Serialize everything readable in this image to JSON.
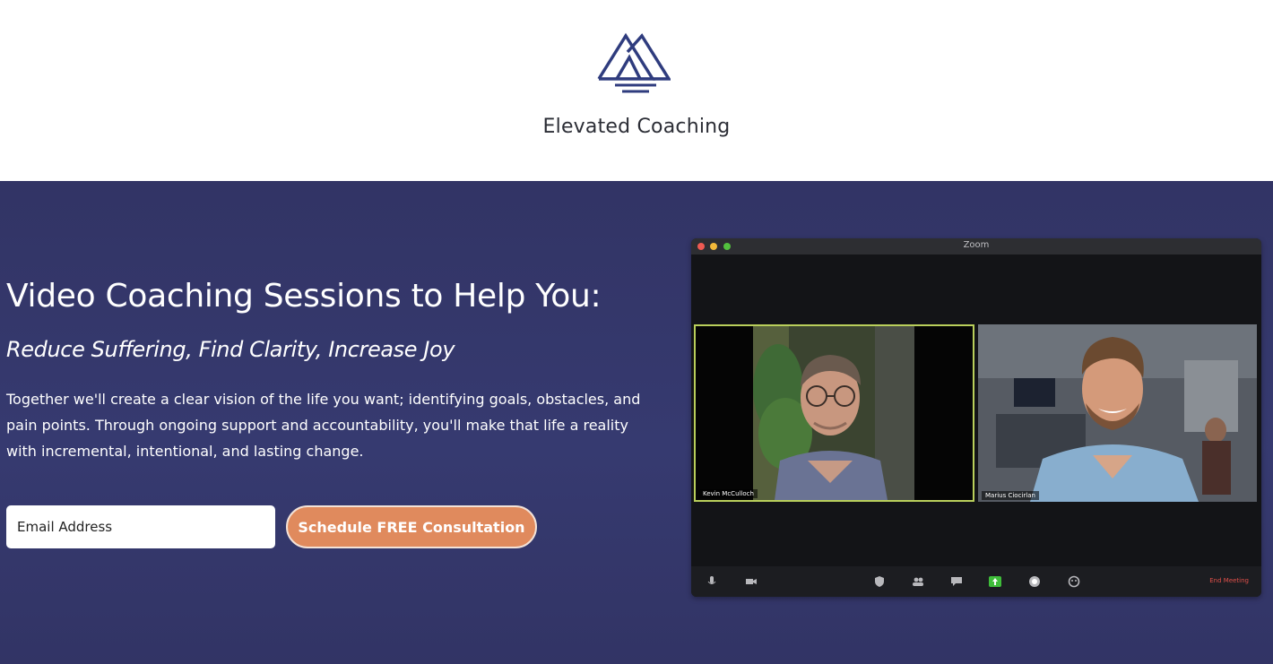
{
  "brand": {
    "name": "Elevated Coaching",
    "logo_icon": "mountain-logo-icon",
    "logo_color": "#2f3c7e"
  },
  "hero": {
    "headline": "Video Coaching Sessions to Help You:",
    "subhead": "Reduce Suffering, Find Clarity, Increase Joy",
    "blurb": "Together we'll create a clear vision of the life you want; identifying goals, obstacles, and pain points. Through ongoing support and accountability, you'll make that life a reality with incremental, intentional, and lasting change.",
    "background": "#343769"
  },
  "form": {
    "email_placeholder": "Email Address",
    "cta_label": "Schedule FREE Consultation",
    "cta_color": "#e08a5d"
  },
  "zoom_window": {
    "title": "Zoom",
    "participants": [
      {
        "name": "Kevin McCulloch",
        "active_speaker": true
      },
      {
        "name": "Marius Ciocirlan",
        "active_speaker": false
      }
    ],
    "toolbar": {
      "icons": [
        "mic-icon",
        "video-icon",
        "security-icon",
        "participants-icon",
        "chat-icon",
        "share-screen-icon",
        "record-icon",
        "reactions-icon"
      ],
      "end_label": "End Meeting"
    }
  }
}
